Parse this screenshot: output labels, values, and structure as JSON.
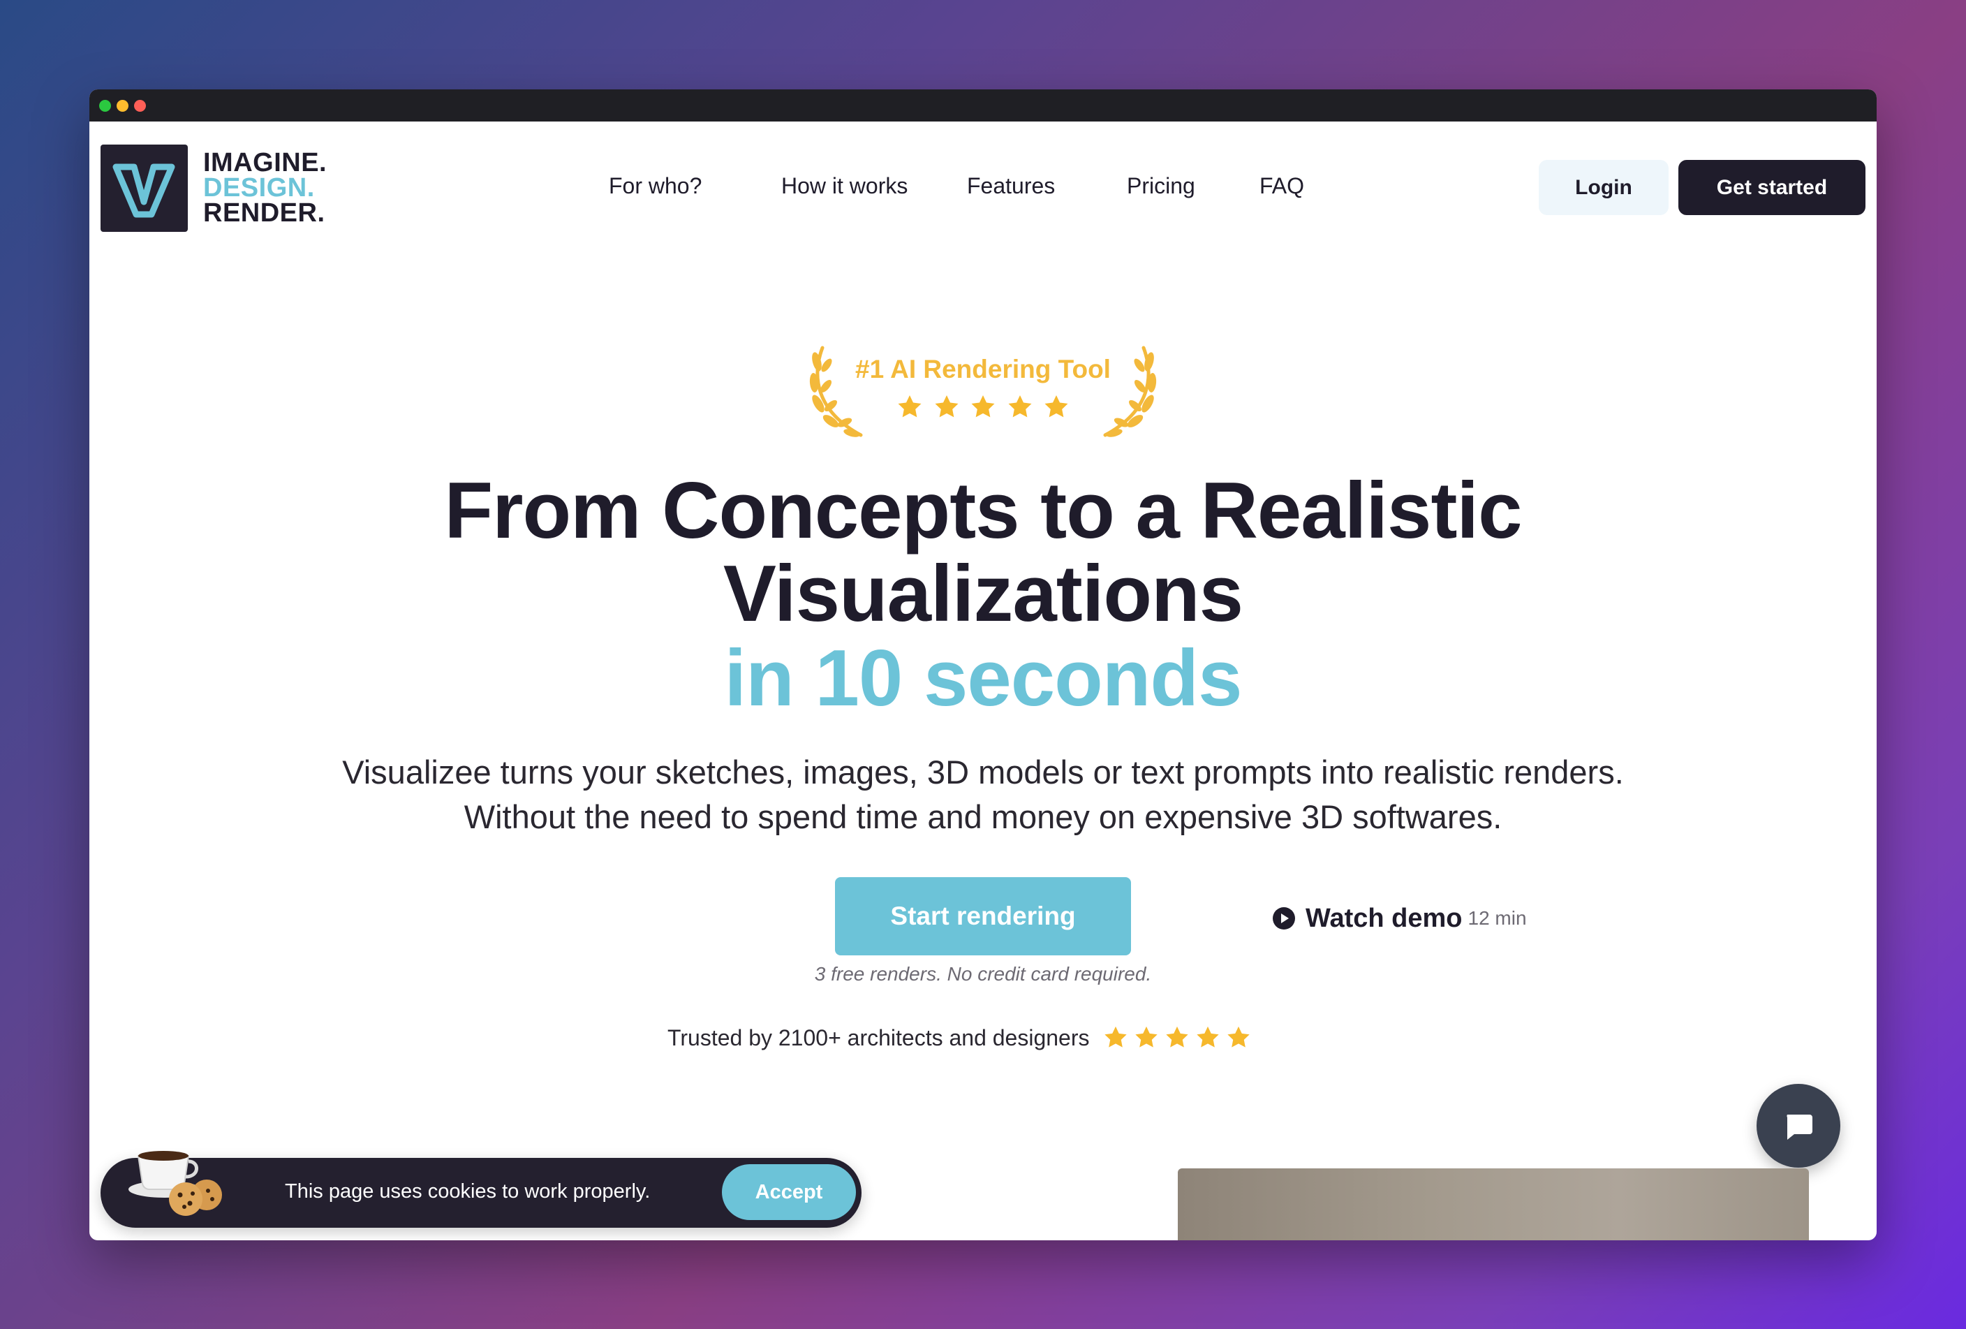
{
  "brand": {
    "logo_letter": "V",
    "line1": "IMAGINE.",
    "line2": "DESIGN.",
    "line3": "RENDER."
  },
  "nav": {
    "items": [
      "For who?",
      "How it works",
      "Features",
      "Pricing",
      "FAQ"
    ],
    "login_label": "Login",
    "cta_label": "Get started"
  },
  "badge": {
    "title": "#1 AI Rendering Tool",
    "rating": 5
  },
  "hero": {
    "line1": "From Concepts to a Realistic",
    "line2": "Visualizations",
    "line3": "in 10 seconds",
    "sub1": "Visualizee turns your sketches, images, 3D models or text prompts into realistic renders.",
    "sub2": "Without the need to spend time and money on expensive 3D softwares.",
    "start_label": "Start rendering",
    "watch_label": "Watch demo",
    "watch_duration": "12 min",
    "free_note": "3 free renders. No credit card required.",
    "trusted": "Trusted by 2100+ architects and designers",
    "trusted_rating": 5
  },
  "cookie": {
    "text": "This page uses cookies to work properly.",
    "accept_label": "Accept"
  },
  "icons": {
    "chat": "chat-bubble-icon",
    "play": "play-circle-icon",
    "cookie": "coffee-cookie-icon",
    "star": "star-icon",
    "laurel": "laurel-icon"
  },
  "colors": {
    "brand_dark": "#1f1c2b",
    "accent": "#6cc3d8",
    "gold": "#f3b93b",
    "star": "#f6b82c"
  }
}
